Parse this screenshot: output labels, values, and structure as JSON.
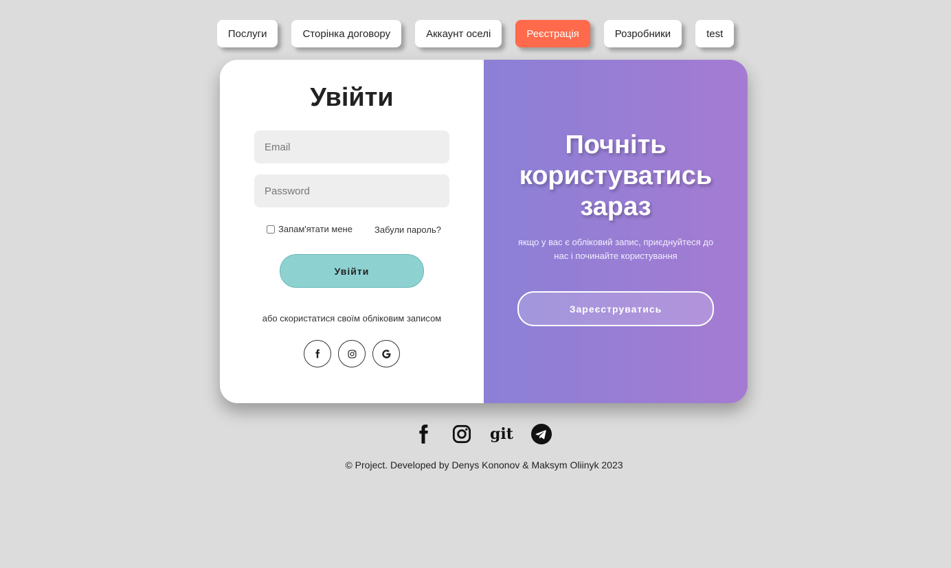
{
  "nav": {
    "items": [
      {
        "label": "Послуги"
      },
      {
        "label": "Сторінка договору"
      },
      {
        "label": "Аккаунт оселі"
      },
      {
        "label": "Реєстрація"
      },
      {
        "label": "Розробники"
      },
      {
        "label": "test"
      }
    ],
    "active_color": "#fe6a4b"
  },
  "login": {
    "title": "Увійти",
    "email_placeholder": "Email",
    "password_placeholder": "Password",
    "remember_label": "Запам'ятати мене",
    "forgot_label": "Забули пароль?",
    "submit_label": "Увійти",
    "alt_text": "або скористатися своїм обліковим записом",
    "social_icons": [
      "facebook-icon",
      "instagram-icon",
      "google-icon"
    ],
    "button_color": "#8ed1d1"
  },
  "promo": {
    "title_line1": "Почніть",
    "title_line2": "користуватись",
    "title_line3": "зараз",
    "text": "якщо у вас є обліковий запис, приєднуйтеся до нас і починайте користування",
    "signup_label": "Зареєструватись",
    "gradient_start": "#8b80d6",
    "gradient_end": "#a57bd2"
  },
  "footer": {
    "icons": [
      "facebook-icon",
      "instagram-icon",
      "git-icon",
      "telegram-icon"
    ],
    "git_label": "git",
    "copyright": "© Project. Developed by Denys Kononov & Maksym Oliinyk 2023"
  }
}
